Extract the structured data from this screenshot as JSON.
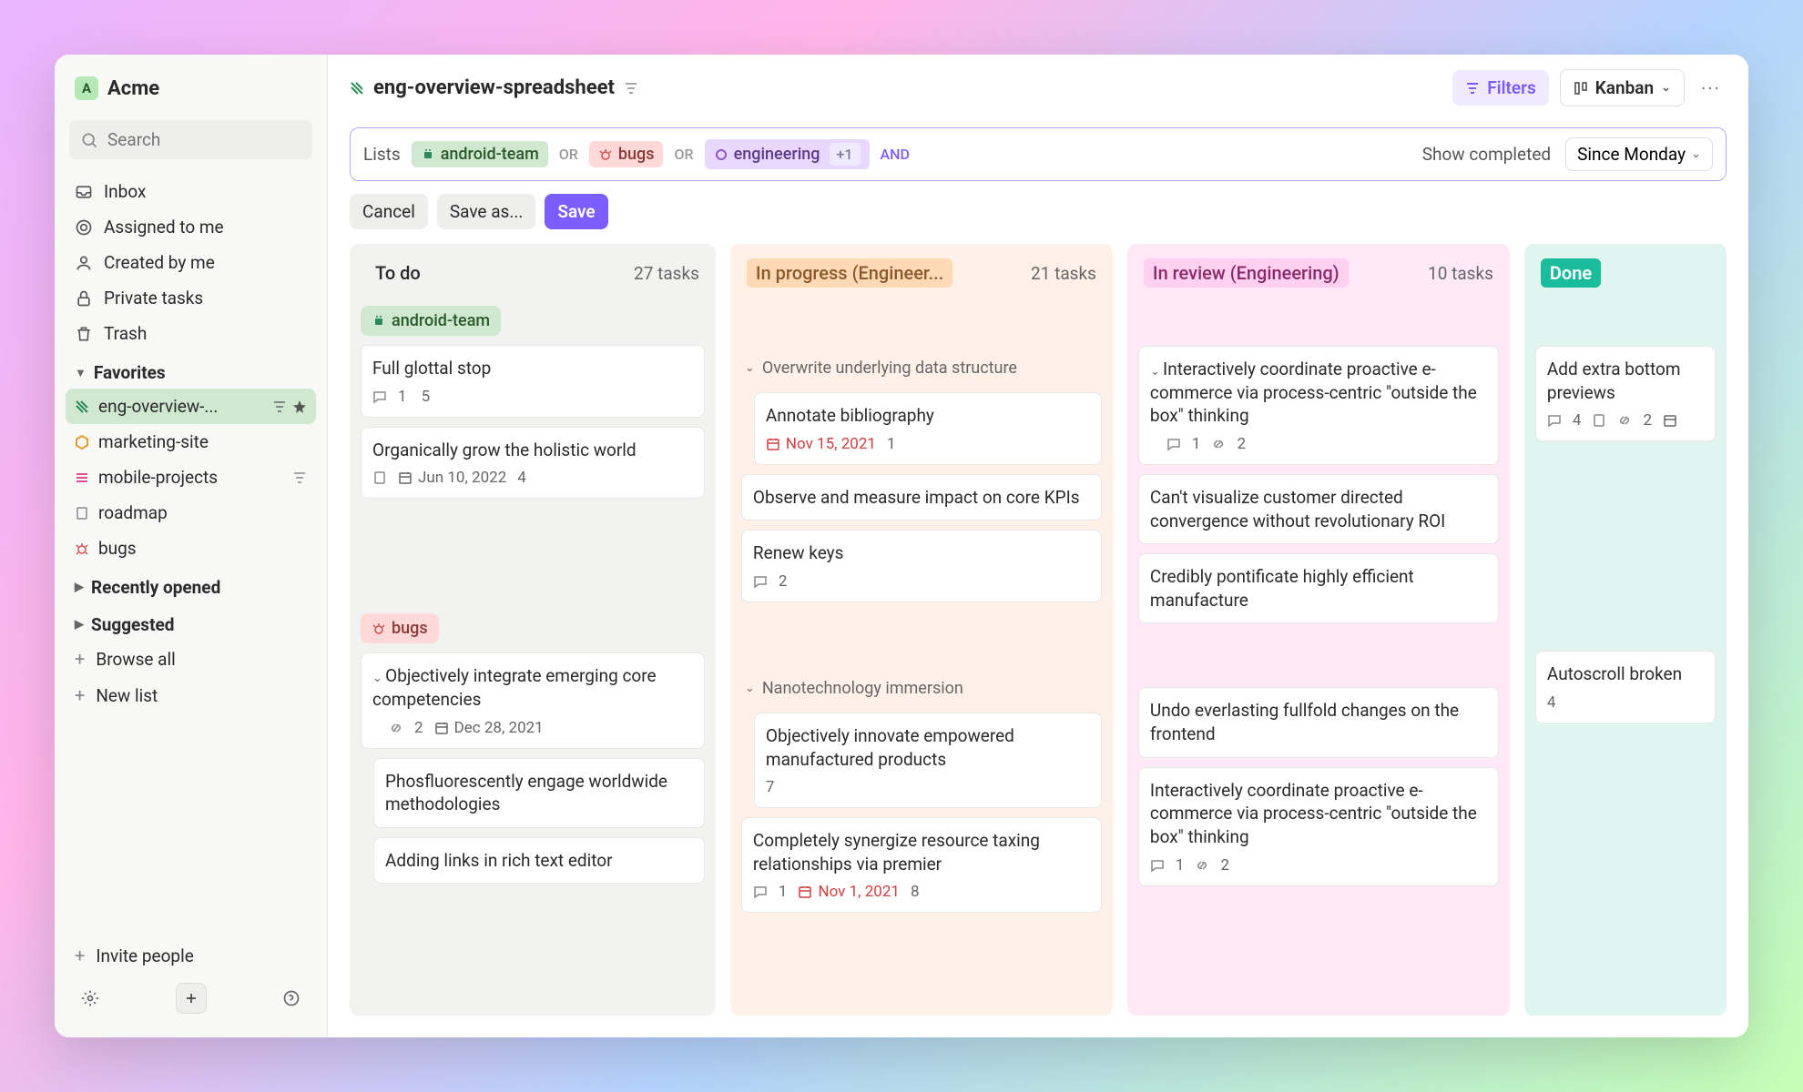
{
  "workspace": {
    "initial": "A",
    "name": "Acme"
  },
  "search": {
    "placeholder": "Search"
  },
  "nav": {
    "inbox": "Inbox",
    "assigned": "Assigned to me",
    "created": "Created by me",
    "private": "Private tasks",
    "trash": "Trash"
  },
  "sections": {
    "favorites": "Favorites",
    "recent": "Recently opened",
    "suggested": "Suggested"
  },
  "favorites": [
    {
      "name": "eng-overview-...",
      "active": true,
      "starred": true
    },
    {
      "name": "marketing-site"
    },
    {
      "name": "mobile-projects",
      "filter": true
    },
    {
      "name": "roadmap"
    },
    {
      "name": "bugs"
    }
  ],
  "footer": {
    "browse": "Browse all",
    "newlist": "New list",
    "invite": "Invite people"
  },
  "topbar": {
    "title": "eng-overview-spreadsheet",
    "filters": "Filters",
    "view": "Kanban"
  },
  "filter": {
    "label": "Lists",
    "tags": {
      "android": "android-team",
      "bugs": "bugs",
      "eng": "engineering",
      "extra": "+1"
    },
    "op": "OR",
    "and": "AND",
    "show": "Show completed",
    "since": "Since Monday"
  },
  "actions": {
    "cancel": "Cancel",
    "saveas": "Save as...",
    "save": "Save"
  },
  "columns": {
    "todo": {
      "title": "To do",
      "count": "27 tasks"
    },
    "progress": {
      "title": "In progress (Engineer...",
      "count": "21 tasks"
    },
    "review": {
      "title": "In review (Engineering)",
      "count": "10 tasks"
    },
    "done": {
      "title": "Done"
    }
  },
  "todo": {
    "group_android": "android-team",
    "card1": {
      "title": "Full glottal stop",
      "comments": "1",
      "count": "5"
    },
    "card2": {
      "title": "Organically grow the holistic world",
      "date": "Jun 10, 2022",
      "count": "4"
    },
    "group_bugs": "bugs",
    "card3": {
      "title": "Objectively integrate emerging core competencies",
      "links": "2",
      "date": "Dec 28, 2021"
    },
    "card4": {
      "title": "Phosfluorescently engage worldwide methodologies"
    },
    "card5": {
      "title": "Adding links in rich text editor"
    }
  },
  "progress": {
    "group1": "Overwrite underlying data structure",
    "card1": {
      "title": "Annotate bibliography",
      "date": "Nov 15, 2021",
      "count": "1"
    },
    "card2": {
      "title": "Observe and measure impact on core KPIs"
    },
    "card3": {
      "title": "Renew keys",
      "comments": "2"
    },
    "group2": "Nanotechnology immersion",
    "card4": {
      "title": "Objectively innovate empowered manufactured products",
      "count": "7"
    },
    "card5": {
      "title": "Completely synergize resource taxing relationships via premier",
      "comments": "1",
      "date": "Nov 1, 2021",
      "count": "8"
    }
  },
  "review": {
    "card1": {
      "title": "Interactively coordinate proactive e-commerce via process-centric \"outside the box\" thinking",
      "comments": "1",
      "links": "2"
    },
    "card2": {
      "title": "Can't visualize customer directed convergence without revolutionary ROI"
    },
    "card3": {
      "title": "Credibly pontificate highly efficient manufacture"
    },
    "card4": {
      "title": "Undo everlasting fullfold changes on the frontend"
    },
    "card5": {
      "title": "Interactively coordinate proactive e-commerce via process-centric \"outside the box\" thinking",
      "comments": "1",
      "links": "2"
    }
  },
  "done": {
    "card1": {
      "title": "Add extra bottom previews",
      "comments": "4",
      "links": "2"
    },
    "card2": {
      "title": "Autoscroll broken",
      "count": "4"
    }
  }
}
